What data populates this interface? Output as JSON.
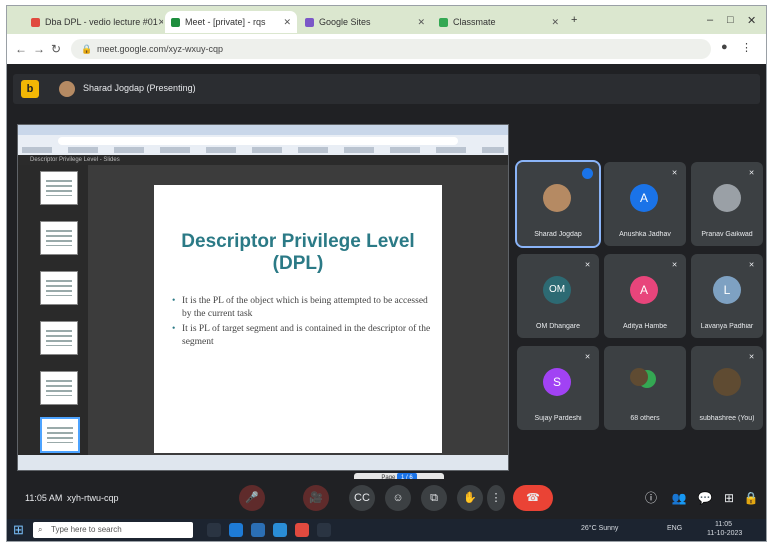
{
  "browser": {
    "tabs": [
      {
        "label": "Dba DPL - vedio lecture #01",
        "active": false,
        "color": "#e04a3f"
      },
      {
        "label": "Meet - [private] - rqs",
        "active": true,
        "color": "#1e8e3e"
      },
      {
        "label": "Google Sites",
        "active": false,
        "color": "#7b57c7"
      },
      {
        "label": "Classmate",
        "active": false,
        "color": "#34a853"
      }
    ],
    "url": "meet.google.com/xyz-wxuy-cqp",
    "controls": {
      "back": "←",
      "forward": "→",
      "reload": "↻",
      "minimize": "–",
      "maximize": "□",
      "close": "✕",
      "new_tab": "+",
      "menu": "⋮"
    }
  },
  "meet": {
    "logo_text": "b",
    "presenter_label": "Sharad Jogdap (Presenting)",
    "viewer_toolbar": "Descriptor Privilege Level - Slides",
    "slide": {
      "title": "Descriptor Privilege Level (DPL)",
      "bullets": [
        "It is the PL of the object which is being attempted to be accessed by the current task",
        "It is PL of target segment and is contained in the descriptor of the segment"
      ],
      "page_indicator": "Page",
      "page_current": "1 / 6"
    },
    "thumbnails_count": 6,
    "participants": [
      {
        "name": "Sharad Jogdap",
        "initial": "",
        "avatar_color": "#b58a63",
        "speaking": true
      },
      {
        "name": "Anushka Jadhav",
        "initial": "A",
        "avatar_color": "#1a73e8",
        "speaking": false
      },
      {
        "name": "Pranav Gaikwad",
        "initial": "",
        "avatar_color": "#9aa0a6",
        "speaking": false
      },
      {
        "name": "OM Dhangare",
        "initial": "OM",
        "avatar_color": "#2d6a73",
        "speaking": false
      },
      {
        "name": "Aditya Hambe",
        "initial": "A",
        "avatar_color": "#e8457b",
        "speaking": false
      },
      {
        "name": "Lavanya Padhiar",
        "initial": "L",
        "avatar_color": "#7ea1c2",
        "speaking": false
      },
      {
        "name": "Sujay Pardeshi",
        "initial": "S",
        "avatar_color": "#a142f4",
        "speaking": false
      },
      {
        "name": "68 others",
        "initial": "",
        "avatar_color": "#34a853",
        "speaking": false
      },
      {
        "name": "subhashree (You)",
        "initial": "",
        "avatar_color": "#5f4b32",
        "speaking": false
      }
    ],
    "meeting_time": "11:05 AM",
    "meeting_code": "xyh-rtwu-cqp",
    "controls": {
      "mic": "🎤",
      "camera": "🎥",
      "captions": "CC",
      "emoji": "☺",
      "present": "⧉",
      "raise_hand": "✋",
      "more": "⋮",
      "leave": "☎",
      "info": "ⓘ",
      "people": "👥",
      "chat": "💬",
      "activities": "⊞",
      "host": "🔒"
    }
  },
  "taskbar": {
    "start_icon": "⊞",
    "search_placeholder": "Type here to search",
    "tray_weather": "26°C Sunny",
    "tray_lang": "ENG",
    "tray_time": "11:05",
    "tray_date": "11-10-2023"
  }
}
